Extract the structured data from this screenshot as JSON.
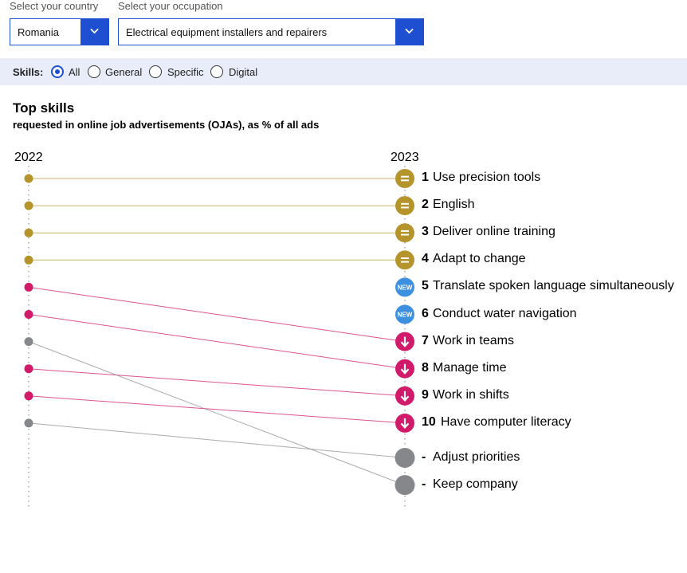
{
  "filters": {
    "country_label": "Select your country",
    "country_value": "Romania",
    "occupation_label": "Select your occupation",
    "occupation_value": "Electrical equipment installers and repairers"
  },
  "skills_filter": {
    "label": "Skills:",
    "options": [
      "All",
      "General",
      "Specific",
      "Digital"
    ],
    "selected": "All"
  },
  "colors": {
    "accent": "#1f4fd1",
    "same": "#b5952b",
    "down": "#d21a6b",
    "new": "#3d8fe0",
    "gone": "#86878b"
  },
  "chart_data": {
    "type": "slope",
    "title": "Top skills",
    "subtitle": "requested in online job advertisements (OJAs), as % of all ads",
    "years": [
      "2022",
      "2023"
    ],
    "skills": [
      {
        "rank": "1",
        "name": "Use precision tools",
        "rank_2022": 1,
        "rank_2023": 1,
        "status": "same",
        "badge": "="
      },
      {
        "rank": "2",
        "name": "English",
        "rank_2022": 2,
        "rank_2023": 2,
        "status": "same",
        "badge": "="
      },
      {
        "rank": "3",
        "name": "Deliver online training",
        "rank_2022": 3,
        "rank_2023": 3,
        "status": "same",
        "badge": "="
      },
      {
        "rank": "4",
        "name": "Adapt to change",
        "rank_2022": 4,
        "rank_2023": 4,
        "status": "same",
        "badge": "="
      },
      {
        "rank": "5",
        "name": "Translate spoken language simultaneously",
        "rank_2022": null,
        "rank_2023": 5,
        "status": "new",
        "badge": "NEW"
      },
      {
        "rank": "6",
        "name": "Conduct water navigation",
        "rank_2022": null,
        "rank_2023": 6,
        "status": "new",
        "badge": "NEW"
      },
      {
        "rank": "7",
        "name": "Work in teams",
        "rank_2022": 5,
        "rank_2023": 7,
        "status": "down",
        "badge": "↓"
      },
      {
        "rank": "8",
        "name": "Manage time",
        "rank_2022": 6,
        "rank_2023": 8,
        "status": "down",
        "badge": "↓"
      },
      {
        "rank": "9",
        "name": "Work in shifts",
        "rank_2022": 8,
        "rank_2023": 9,
        "status": "down",
        "badge": "↓"
      },
      {
        "rank": "10",
        "name": "Have computer literacy",
        "rank_2022": 9,
        "rank_2023": 10,
        "status": "down",
        "badge": "↓"
      },
      {
        "rank": "-",
        "name": "Adjust priorities",
        "rank_2022": 10,
        "rank_2023": null,
        "status": "gone",
        "badge": ""
      },
      {
        "rank": "-",
        "name": "Keep company",
        "rank_2022": 7,
        "rank_2023": null,
        "status": "gone",
        "badge": ""
      }
    ]
  }
}
